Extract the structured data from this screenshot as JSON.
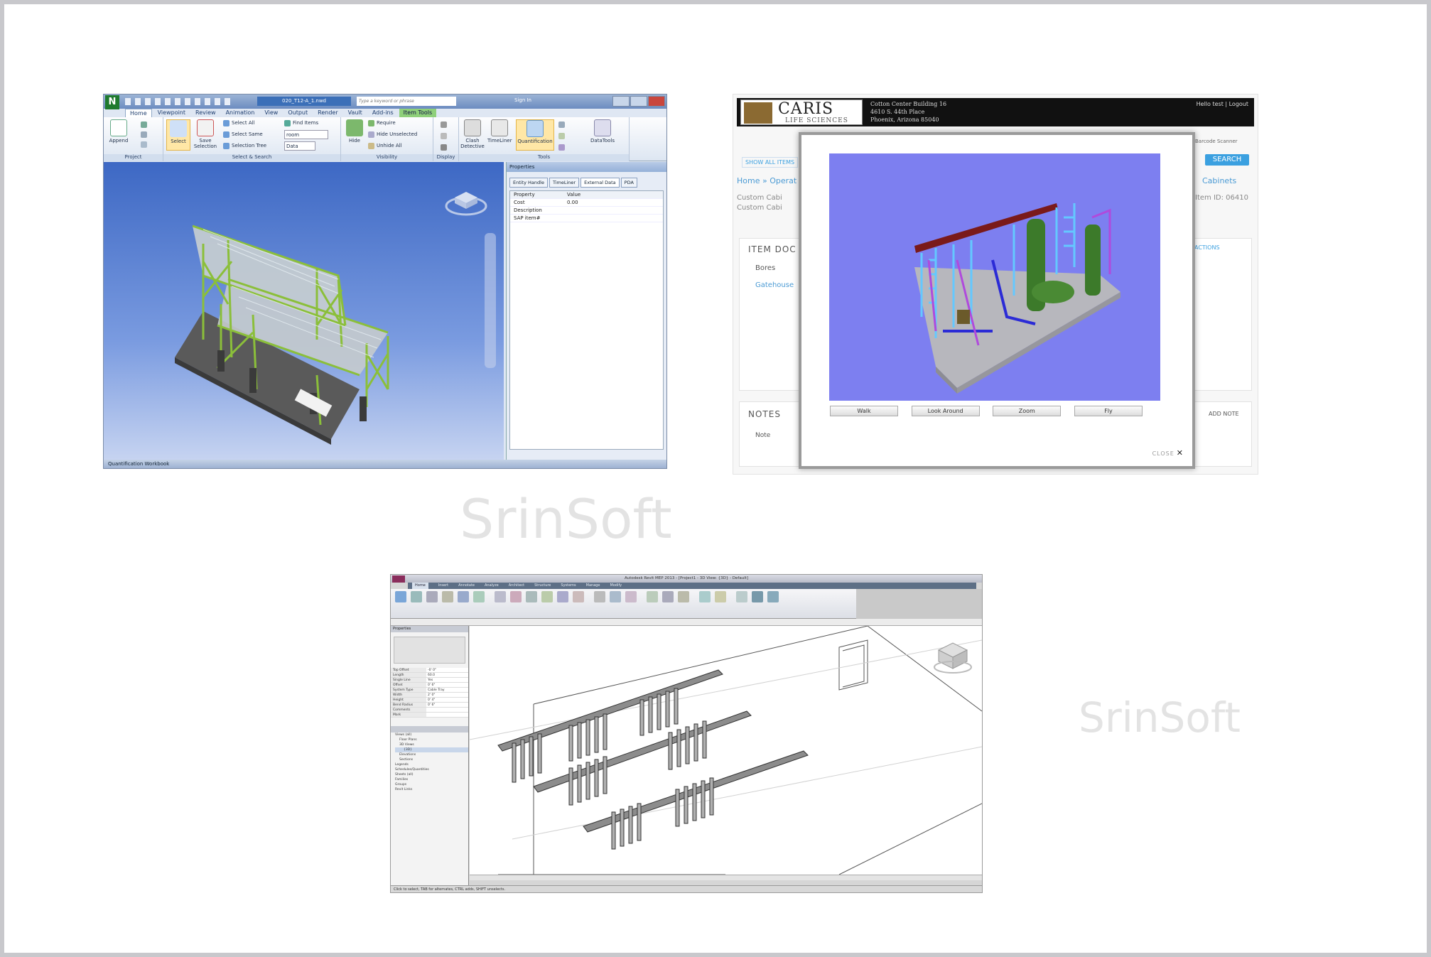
{
  "watermarks": {
    "center": "SrinSoft",
    "right": "SrinSoft"
  },
  "navisworks": {
    "title_file": "020_T12-A_1.nwd",
    "search_placeholder": "Type a keyword or phrase",
    "sign_in": "Sign In",
    "tabs": [
      "Home",
      "Viewpoint",
      "Review",
      "Animation",
      "View",
      "Output",
      "Render",
      "Vault",
      "Add-ins",
      "Item Tools"
    ],
    "ribbon": {
      "append": "Append",
      "select": "Select",
      "save_selection": "Save Selection",
      "select_all": "Select All",
      "select_same": "Select Same",
      "selection_tree": "Selection Tree",
      "find_items": "Find Items",
      "find_field": "room",
      "find_dropdown": "Data",
      "hide": "Hide",
      "require": "Require",
      "hide_unselected": "Hide Unselected",
      "unhide_all": "Unhide All",
      "clash_detective": "Clash Detective",
      "timeliner": "TimeLiner",
      "quantification": "Quantification",
      "datatools": "DataTools",
      "groups": {
        "project": "Project",
        "select_search": "Select & Search",
        "visibility": "Visibility",
        "display": "Display",
        "tools": "Tools"
      }
    },
    "properties": {
      "title": "Properties",
      "tabs": [
        "Entity Handle",
        "TimeLiner",
        "External Data",
        "PDA"
      ],
      "header_property": "Property",
      "header_value": "Value",
      "rows": [
        {
          "key": "Cost",
          "value": "0.00"
        },
        {
          "key": "Description",
          "value": ""
        },
        {
          "key": "SAP item#",
          "value": ""
        }
      ]
    },
    "status": "Quantification Workbook"
  },
  "caris": {
    "logo_main": "CARIS",
    "logo_sub": "LIFE SCIENCES",
    "address": [
      "Cotton Center Building 16",
      "4610 S. 44th Place",
      "Phoenix, Arizona 85040"
    ],
    "user": "Hello test | Logout",
    "show_all": "SHOW ALL ITEMS",
    "barcode": "Barcode Scanner",
    "search": "SEARCH",
    "breadcrumb": "Home » Operat",
    "breadcrumb_right": "Cabinets",
    "custom1": "Custom Cabi",
    "custom2": "Custom Cabi",
    "item_id": "Item ID: 06410",
    "item_docs": "ITEM DOC",
    "actions": "ACTIONS",
    "doc_name": "Bores",
    "doc_link": "Gatehouse",
    "notes": "NOTES",
    "add_note": "ADD NOTE",
    "note_label": "Note",
    "modes": [
      "Walk",
      "Look Around",
      "Zoom",
      "Fly"
    ],
    "close": "CLOSE"
  },
  "revit": {
    "title": "Autodesk Revit MEP 2013 - [Project1 - 3D View: {3D} - Default]",
    "tabs": [
      "Home",
      "Insert",
      "Annotate",
      "Analyze",
      "Architect",
      "Structure",
      "Systems",
      "Manage",
      "Modify"
    ],
    "properties_title": "Properties",
    "properties": [
      {
        "k": "Top Offset",
        "v": "-0' 0\""
      },
      {
        "k": "Length",
        "v": "60.0"
      },
      {
        "k": "Single Line",
        "v": "Yes"
      },
      {
        "k": "Offset",
        "v": "0' 6\""
      },
      {
        "k": "System Type",
        "v": "Cable Tray"
      },
      {
        "k": "Width",
        "v": "2' 0\""
      },
      {
        "k": "Height",
        "v": "0' 4\""
      },
      {
        "k": "Bend Radius",
        "v": "0' 6\""
      },
      {
        "k": "Comments",
        "v": ""
      },
      {
        "k": "Mark",
        "v": ""
      }
    ],
    "tree": [
      "Views (all)",
      "Floor Plans",
      "3D Views",
      "{3D}",
      "Elevations",
      "Sections",
      "Legends",
      "Schedules/Quantities",
      "Sheets (all)",
      "Families",
      "Groups",
      "Revit Links"
    ],
    "status": "Click to select, TAB for alternates, CTRL adds, SHIFT unselects."
  }
}
